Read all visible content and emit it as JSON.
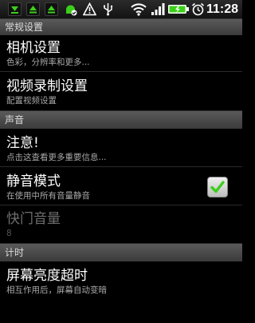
{
  "status_bar": {
    "time": "11:28",
    "icons": [
      "download-icon",
      "upload-icon",
      "android-update-icon",
      "warning-icon",
      "usb-icon",
      "wifi-icon",
      "signal-icon",
      "battery-charging-icon",
      "alarm-icon"
    ],
    "accent_green": "#3ccf1a"
  },
  "sections": [
    {
      "header": "常规设置",
      "items": [
        {
          "title": "相机设置",
          "summary": "色彩，分辨率和更多..."
        },
        {
          "title": "视频录制设置",
          "summary": "配置视频设置"
        }
      ]
    },
    {
      "header": "声音",
      "items": [
        {
          "title": "注意!",
          "summary": "点击这查看更多重要信息..."
        },
        {
          "title": "静音模式",
          "summary": "在使用中所有音量静音",
          "checked": true
        },
        {
          "title": "快门音量",
          "summary": "8",
          "disabled": true
        }
      ]
    },
    {
      "header": "计时",
      "items": [
        {
          "title": "屏幕亮度超时",
          "summary": "相互作用后，屏幕自动变暗"
        }
      ]
    }
  ]
}
